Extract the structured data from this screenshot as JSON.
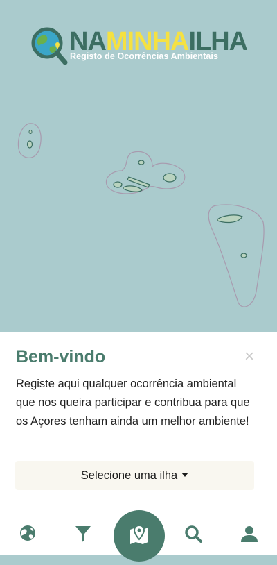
{
  "brand": {
    "logo_part1": "NA",
    "logo_part2": "MINHA",
    "logo_part3": "ILHA",
    "tagline": "Registo de Ocorrências Ambientais",
    "colors": {
      "primary": "#4a7c6d",
      "accent": "#f5e142",
      "map_water": "#aacbcd"
    }
  },
  "welcome": {
    "title": "Bem-vindo",
    "close_symbol": "×",
    "message": "Registe aqui qualquer ocorrência ambiental que nos queira participar e contribua para que os Açores tenham ainda um melhor ambiente!",
    "select_label": "Selecione uma ilha"
  },
  "bottom_nav": {
    "items": [
      {
        "icon": "globe-icon"
      },
      {
        "icon": "filter-icon"
      },
      {
        "icon": "map-marker-icon",
        "active": true
      },
      {
        "icon": "search-icon"
      },
      {
        "icon": "user-icon"
      }
    ]
  }
}
